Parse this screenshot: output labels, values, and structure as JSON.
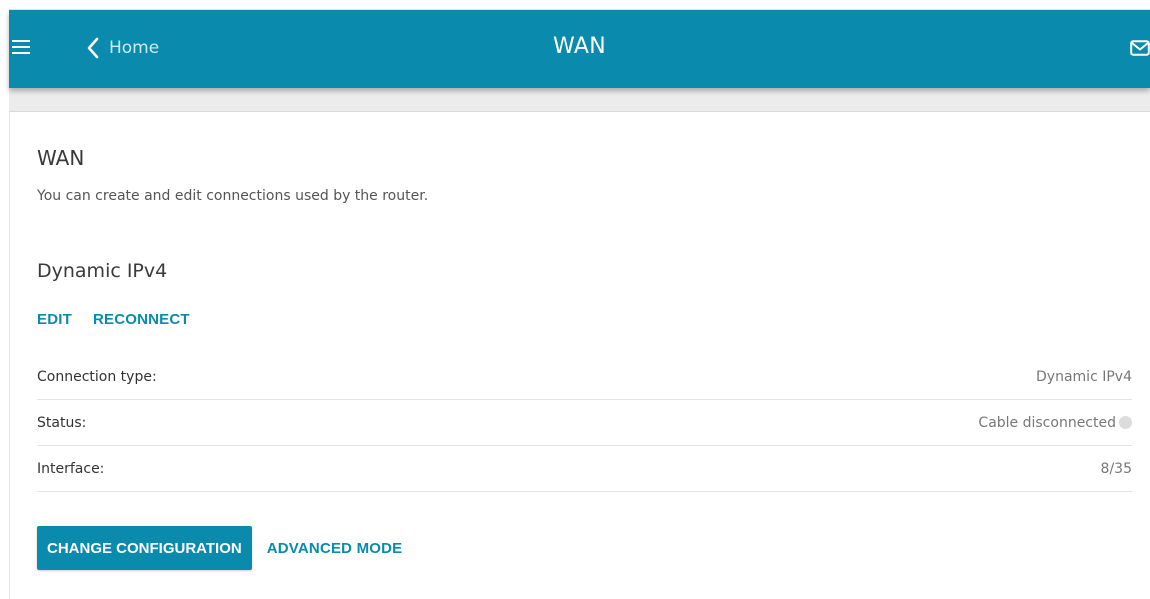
{
  "header": {
    "back_label": "Home",
    "title": "WAN",
    "icons": [
      "menu-icon",
      "chevron-left-icon",
      "mail-icon"
    ]
  },
  "section": {
    "title": "WAN",
    "description": "You can create and edit connections used by the router."
  },
  "connection": {
    "name": "Dynamic IPv4",
    "actions": {
      "edit": "EDIT",
      "reconnect": "RECONNECT"
    },
    "rows": [
      {
        "label": "Connection type:",
        "value": "Dynamic IPv4"
      },
      {
        "label": "Status:",
        "value": "Cable disconnected"
      },
      {
        "label": "Interface:",
        "value": "8/35"
      }
    ]
  },
  "buttons": {
    "change_configuration": "CHANGE CONFIGURATION",
    "advanced_mode": "ADVANCED MODE"
  },
  "colors": {
    "accent": "#0a8bad",
    "status_dot": "#dcdcdc"
  }
}
